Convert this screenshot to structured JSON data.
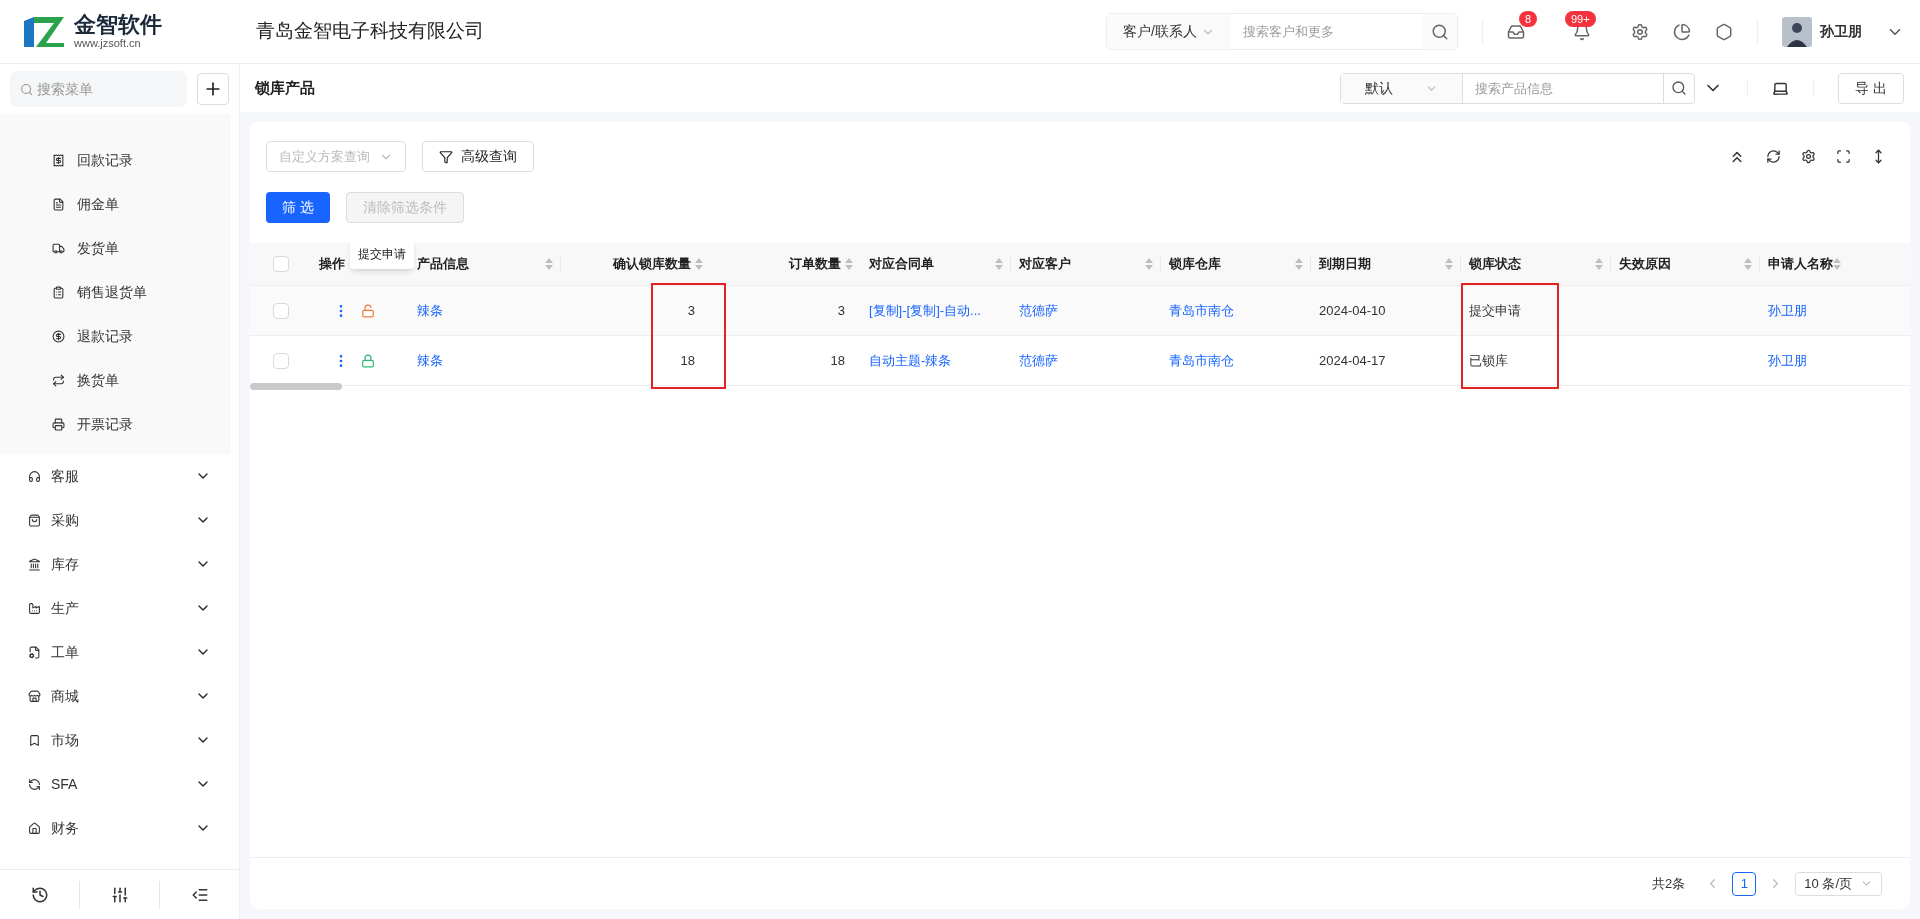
{
  "header": {
    "logo_name": "金智软件",
    "logo_url": "www.jzsoft.cn",
    "company": "青岛金智电子科技有限公司",
    "search": {
      "scope": "客户/联系人",
      "placeholder": "搜索客户和更多"
    },
    "badges": [
      "8",
      "99+"
    ],
    "user": "孙卫朋"
  },
  "sidebar": {
    "search_placeholder": "搜索菜单",
    "sub_items": [
      {
        "label": "回款记录"
      },
      {
        "label": "佣金单"
      },
      {
        "label": "发货单"
      },
      {
        "label": "销售退货单"
      },
      {
        "label": "退款记录"
      },
      {
        "label": "换货单"
      },
      {
        "label": "开票记录"
      }
    ],
    "groups": [
      {
        "label": "客服",
        "expanded": false
      },
      {
        "label": "采购",
        "expanded": false
      },
      {
        "label": "库存",
        "expanded": false
      },
      {
        "label": "生产",
        "expanded": false
      },
      {
        "label": "工单",
        "expanded": false
      },
      {
        "label": "商城",
        "expanded": false
      },
      {
        "label": "市场",
        "expanded": false
      },
      {
        "label": "SFA",
        "expanded": false
      },
      {
        "label": "财务",
        "expanded": false
      }
    ]
  },
  "page": {
    "title": "锁库产品",
    "search": {
      "scope": "默认",
      "placeholder": "搜索产品信息"
    },
    "export": "导 出"
  },
  "toolbar": {
    "scheme_placeholder": "自定义方案查询",
    "advanced": "高级查询",
    "filter": "筛 选",
    "clear": {
      "label": "清除筛选条件",
      "disabled": true
    }
  },
  "table": {
    "all_checked": false,
    "columns": [
      {
        "label": "操作",
        "sortable": false,
        "highlighted": false
      },
      {
        "label": "产品信息",
        "sortable": true,
        "highlighted": false
      },
      {
        "label": "确认锁库数量",
        "sortable": true,
        "highlighted": true
      },
      {
        "label": "订单数量",
        "sortable": true,
        "highlighted": false
      },
      {
        "label": "对应合同单",
        "sortable": true,
        "highlighted": false
      },
      {
        "label": "对应客户",
        "sortable": true,
        "highlighted": false
      },
      {
        "label": "锁库仓库",
        "sortable": true,
        "highlighted": false
      },
      {
        "label": "到期日期",
        "sortable": true,
        "highlighted": false
      },
      {
        "label": "锁库状态",
        "sortable": true,
        "highlighted": true
      },
      {
        "label": "失效原因",
        "sortable": true,
        "highlighted": false
      },
      {
        "label": "申请人名称",
        "sortable": true,
        "highlighted": false
      }
    ],
    "rows": [
      {
        "checked": false,
        "hovered": true,
        "locked": false,
        "cells": [
          "",
          "辣条",
          "3",
          "3",
          "[复制]-[复制]-自动...",
          "范德萨",
          "青岛市南仓",
          "2024-04-10",
          "提交申请",
          null,
          "孙卫朋"
        ]
      },
      {
        "checked": false,
        "hovered": false,
        "locked": true,
        "cells": [
          "",
          "辣条",
          "18",
          "18",
          "自动主题-辣条",
          "范德萨",
          "青岛市南仓",
          "2024-04-17",
          "已锁库",
          null,
          "孙卫朋"
        ]
      }
    ],
    "tooltip": "提交申请"
  },
  "pagination": {
    "total": "共2条",
    "pages": [
      {
        "label": "1",
        "selected": true
      }
    ],
    "page_size": "10 条/页"
  }
}
